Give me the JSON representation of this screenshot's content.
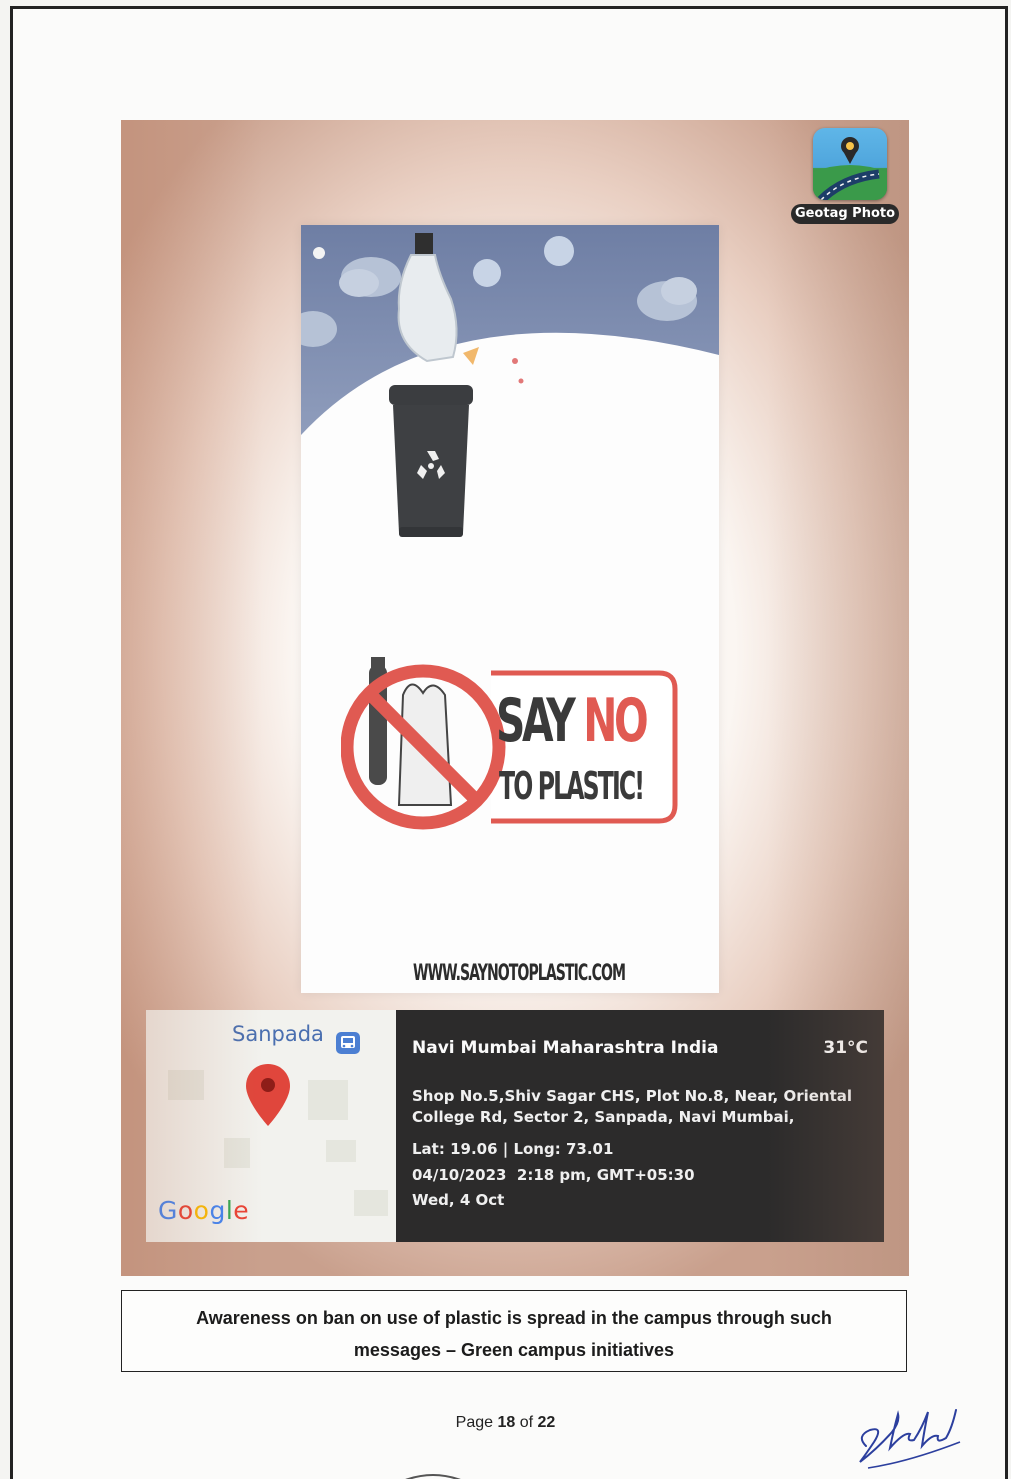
{
  "photo": {
    "geotag_badge_label": "Geotag Photo",
    "poster": {
      "headline_say": "SAY",
      "headline_no": "NO",
      "headline_line2": "TO PLASTIC!",
      "url": "WWW.SAYNOTOPLASTIC.COM"
    },
    "map": {
      "area_label": "Sanpada",
      "logo": [
        "G",
        "o",
        "o",
        "g",
        "l",
        "e"
      ],
      "logo_colors": [
        "#4285F4",
        "#EA4335",
        "#FBBC05",
        "#4285F4",
        "#34A853",
        "#EA4335"
      ]
    },
    "geotag": {
      "location": "Navi Mumbai Maharashtra India",
      "temperature": "31°C",
      "address": "Shop No.5,Shiv Sagar CHS, Plot No.8, Near, Oriental College Rd, Sector 2, Sanpada, Navi Mumbai,",
      "lat_long": "Lat: 19.06 | Long: 73.01",
      "datetime": "04/10/2023  2:18 pm, GMT+05:30",
      "day": "Wed, 4 Oct"
    }
  },
  "caption": {
    "line1": "Awareness on ban on use of plastic is spread in the campus through such",
    "line2": "messages – Green campus initiatives"
  },
  "footer": {
    "page_prefix": "Page",
    "page_current": "18",
    "page_separator": "of",
    "page_total": "22"
  },
  "icons": {
    "geotag_app": "geotag-app-icon",
    "recycle": "recycle-icon",
    "no_plastic": "prohibition-icon",
    "map_pin": "map-pin-icon",
    "bus_stop": "bus-stop-icon"
  },
  "colors": {
    "sign_red": "#e05a52",
    "info_panel_bg": "#2c2b2b",
    "poster_sky": "#7e8fb6"
  }
}
